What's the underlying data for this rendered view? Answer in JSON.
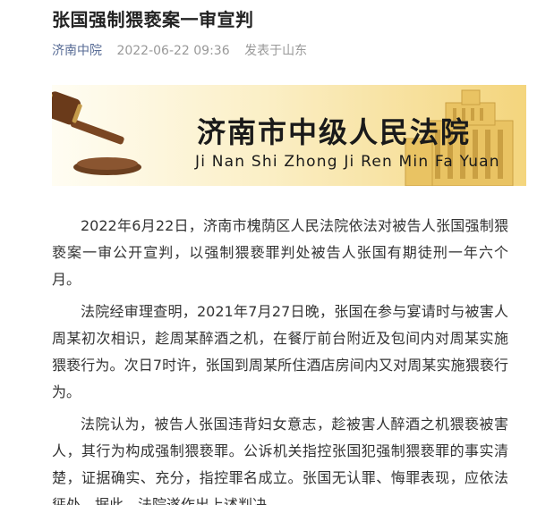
{
  "article": {
    "title": "张国强制猥亵案一审宣判",
    "source": "济南中院",
    "datetime": "2022-06-22 09:36",
    "location": "发表于山东"
  },
  "banner": {
    "title": "济南市中级人民法院",
    "subtitle": "Ji Nan Shi Zhong Ji Ren Min Fa Yuan",
    "icons": [
      "gavel-icon",
      "court-building-icon"
    ]
  },
  "paragraphs": [
    "2022年6月22日，济南市槐荫区人民法院依法对被告人张国强制猥亵案一审公开宣判，以强制猥亵罪判处被告人张国有期徒刑一年六个月。",
    "法院经审理查明，2021年7月27日晚，张国在参与宴请时与被害人周某初次相识，趁周某醉酒之机，在餐厅前台附近及包间内对周某实施猥亵行为。次日7时许，张国到周某所住酒店房间内又对周某实施猥亵行为。",
    "法院认为，被告人张国违背妇女意志，趁被害人醉酒之机猥亵被害人，其行为构成强制猥亵罪。公诉机关指控张国犯强制猥亵罪的事实清楚，证据确实、充分，指控罪名成立。张国无认罪、悔罪表现，应依法惩处。据此，法院遂作出上述判决。"
  ]
}
